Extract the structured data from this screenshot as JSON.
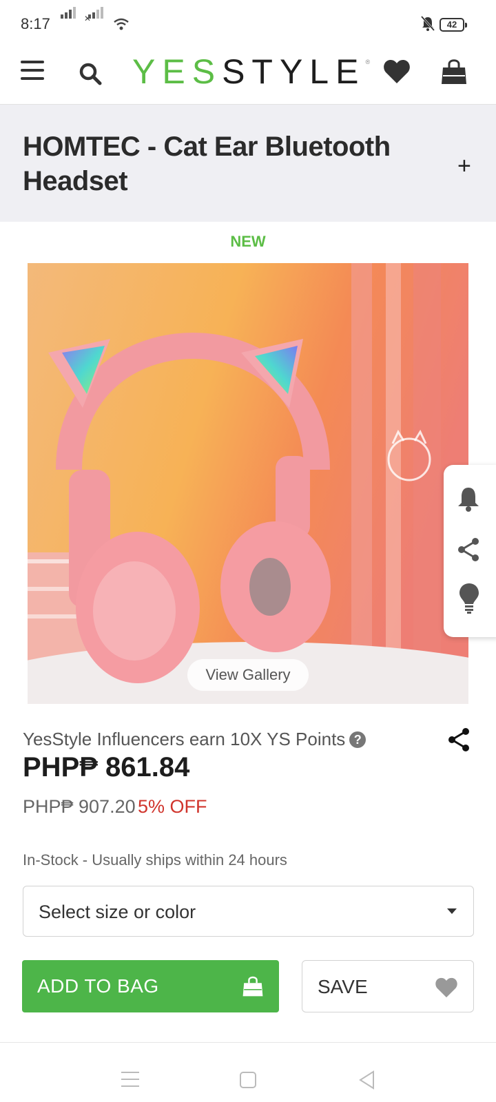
{
  "status_bar": {
    "time": "8:17",
    "battery": "42",
    "icons": [
      "signal-icon",
      "signal-no-sim-icon",
      "wifi-icon",
      "notifications-off-icon",
      "battery-icon"
    ]
  },
  "header": {
    "brand_yes": "YES",
    "brand_style": "STYLE",
    "brand_mark": "®",
    "icons": [
      "menu-icon",
      "search-icon",
      "heart-icon",
      "shopping-bag-icon"
    ]
  },
  "product": {
    "title": "HOMTEC - Cat Ear Bluetooth Headset",
    "badge": "NEW",
    "view_gallery": "View Gallery",
    "influencer_text": "YesStyle Influencers earn 10X YS Points",
    "help_glyph": "?",
    "price": "PHP₱ 861.84",
    "original_price": "PHP₱ 907.20",
    "discount": "5% OFF",
    "stock": "In-Stock - Usually ships within 24 hours",
    "select_placeholder": "Select size or color",
    "add_to_bag": "ADD TO BAG",
    "save": "SAVE"
  },
  "side_panel": {
    "icons": [
      "notification-bell-icon",
      "share-icon",
      "lightbulb-icon"
    ]
  },
  "colors": {
    "brand_green": "#5cbd46",
    "button_green": "#4db549",
    "discount_red": "#d0342c",
    "title_bg": "#efeff3"
  }
}
